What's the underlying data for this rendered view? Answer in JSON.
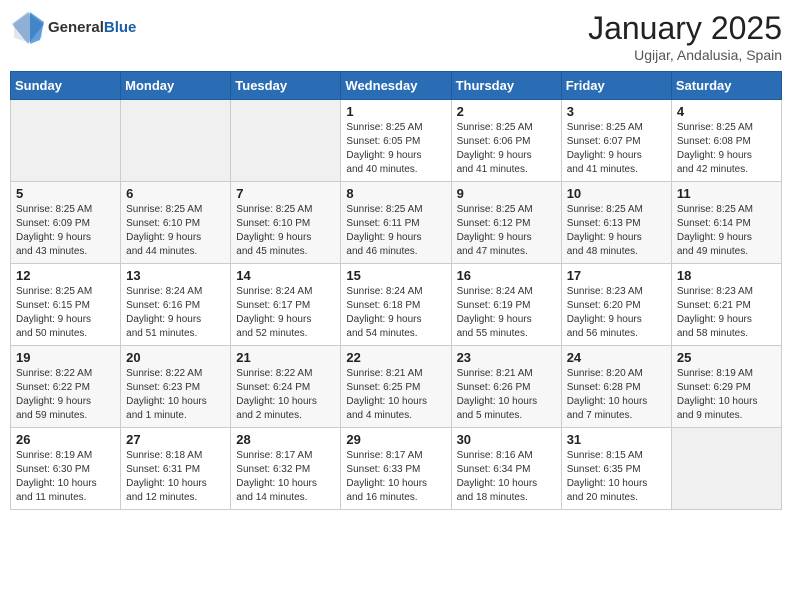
{
  "logo": {
    "text_general": "General",
    "text_blue": "Blue"
  },
  "title": "January 2025",
  "location": "Ugijar, Andalusia, Spain",
  "weekdays": [
    "Sunday",
    "Monday",
    "Tuesday",
    "Wednesday",
    "Thursday",
    "Friday",
    "Saturday"
  ],
  "weeks": [
    [
      {
        "day": "",
        "info": ""
      },
      {
        "day": "",
        "info": ""
      },
      {
        "day": "",
        "info": ""
      },
      {
        "day": "1",
        "info": "Sunrise: 8:25 AM\nSunset: 6:05 PM\nDaylight: 9 hours\nand 40 minutes."
      },
      {
        "day": "2",
        "info": "Sunrise: 8:25 AM\nSunset: 6:06 PM\nDaylight: 9 hours\nand 41 minutes."
      },
      {
        "day": "3",
        "info": "Sunrise: 8:25 AM\nSunset: 6:07 PM\nDaylight: 9 hours\nand 41 minutes."
      },
      {
        "day": "4",
        "info": "Sunrise: 8:25 AM\nSunset: 6:08 PM\nDaylight: 9 hours\nand 42 minutes."
      }
    ],
    [
      {
        "day": "5",
        "info": "Sunrise: 8:25 AM\nSunset: 6:09 PM\nDaylight: 9 hours\nand 43 minutes."
      },
      {
        "day": "6",
        "info": "Sunrise: 8:25 AM\nSunset: 6:10 PM\nDaylight: 9 hours\nand 44 minutes."
      },
      {
        "day": "7",
        "info": "Sunrise: 8:25 AM\nSunset: 6:10 PM\nDaylight: 9 hours\nand 45 minutes."
      },
      {
        "day": "8",
        "info": "Sunrise: 8:25 AM\nSunset: 6:11 PM\nDaylight: 9 hours\nand 46 minutes."
      },
      {
        "day": "9",
        "info": "Sunrise: 8:25 AM\nSunset: 6:12 PM\nDaylight: 9 hours\nand 47 minutes."
      },
      {
        "day": "10",
        "info": "Sunrise: 8:25 AM\nSunset: 6:13 PM\nDaylight: 9 hours\nand 48 minutes."
      },
      {
        "day": "11",
        "info": "Sunrise: 8:25 AM\nSunset: 6:14 PM\nDaylight: 9 hours\nand 49 minutes."
      }
    ],
    [
      {
        "day": "12",
        "info": "Sunrise: 8:25 AM\nSunset: 6:15 PM\nDaylight: 9 hours\nand 50 minutes."
      },
      {
        "day": "13",
        "info": "Sunrise: 8:24 AM\nSunset: 6:16 PM\nDaylight: 9 hours\nand 51 minutes."
      },
      {
        "day": "14",
        "info": "Sunrise: 8:24 AM\nSunset: 6:17 PM\nDaylight: 9 hours\nand 52 minutes."
      },
      {
        "day": "15",
        "info": "Sunrise: 8:24 AM\nSunset: 6:18 PM\nDaylight: 9 hours\nand 54 minutes."
      },
      {
        "day": "16",
        "info": "Sunrise: 8:24 AM\nSunset: 6:19 PM\nDaylight: 9 hours\nand 55 minutes."
      },
      {
        "day": "17",
        "info": "Sunrise: 8:23 AM\nSunset: 6:20 PM\nDaylight: 9 hours\nand 56 minutes."
      },
      {
        "day": "18",
        "info": "Sunrise: 8:23 AM\nSunset: 6:21 PM\nDaylight: 9 hours\nand 58 minutes."
      }
    ],
    [
      {
        "day": "19",
        "info": "Sunrise: 8:22 AM\nSunset: 6:22 PM\nDaylight: 9 hours\nand 59 minutes."
      },
      {
        "day": "20",
        "info": "Sunrise: 8:22 AM\nSunset: 6:23 PM\nDaylight: 10 hours\nand 1 minute."
      },
      {
        "day": "21",
        "info": "Sunrise: 8:22 AM\nSunset: 6:24 PM\nDaylight: 10 hours\nand 2 minutes."
      },
      {
        "day": "22",
        "info": "Sunrise: 8:21 AM\nSunset: 6:25 PM\nDaylight: 10 hours\nand 4 minutes."
      },
      {
        "day": "23",
        "info": "Sunrise: 8:21 AM\nSunset: 6:26 PM\nDaylight: 10 hours\nand 5 minutes."
      },
      {
        "day": "24",
        "info": "Sunrise: 8:20 AM\nSunset: 6:28 PM\nDaylight: 10 hours\nand 7 minutes."
      },
      {
        "day": "25",
        "info": "Sunrise: 8:19 AM\nSunset: 6:29 PM\nDaylight: 10 hours\nand 9 minutes."
      }
    ],
    [
      {
        "day": "26",
        "info": "Sunrise: 8:19 AM\nSunset: 6:30 PM\nDaylight: 10 hours\nand 11 minutes."
      },
      {
        "day": "27",
        "info": "Sunrise: 8:18 AM\nSunset: 6:31 PM\nDaylight: 10 hours\nand 12 minutes."
      },
      {
        "day": "28",
        "info": "Sunrise: 8:17 AM\nSunset: 6:32 PM\nDaylight: 10 hours\nand 14 minutes."
      },
      {
        "day": "29",
        "info": "Sunrise: 8:17 AM\nSunset: 6:33 PM\nDaylight: 10 hours\nand 16 minutes."
      },
      {
        "day": "30",
        "info": "Sunrise: 8:16 AM\nSunset: 6:34 PM\nDaylight: 10 hours\nand 18 minutes."
      },
      {
        "day": "31",
        "info": "Sunrise: 8:15 AM\nSunset: 6:35 PM\nDaylight: 10 hours\nand 20 minutes."
      },
      {
        "day": "",
        "info": ""
      }
    ]
  ]
}
